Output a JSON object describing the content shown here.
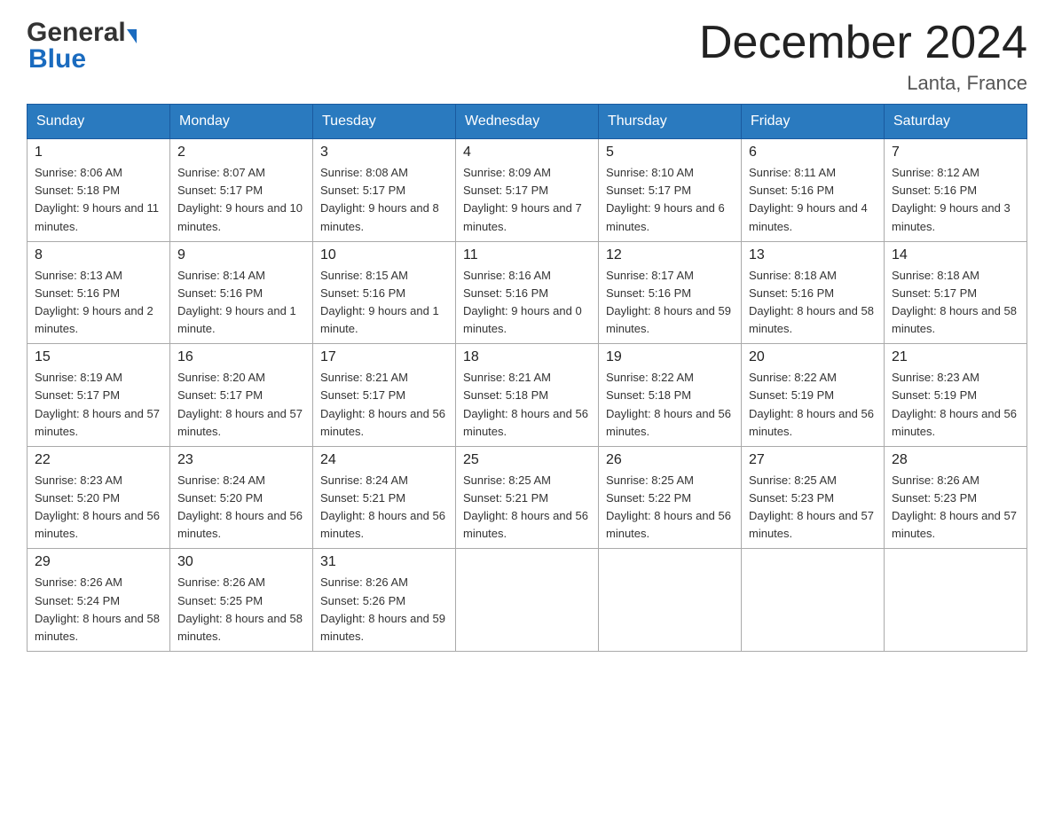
{
  "logo": {
    "general": "General",
    "blue": "Blue"
  },
  "header": {
    "month_year": "December 2024",
    "location": "Lanta, France"
  },
  "columns": [
    "Sunday",
    "Monday",
    "Tuesday",
    "Wednesday",
    "Thursday",
    "Friday",
    "Saturday"
  ],
  "weeks": [
    [
      {
        "day": "1",
        "sunrise": "8:06 AM",
        "sunset": "5:18 PM",
        "daylight": "9 hours and 11 minutes."
      },
      {
        "day": "2",
        "sunrise": "8:07 AM",
        "sunset": "5:17 PM",
        "daylight": "9 hours and 10 minutes."
      },
      {
        "day": "3",
        "sunrise": "8:08 AM",
        "sunset": "5:17 PM",
        "daylight": "9 hours and 8 minutes."
      },
      {
        "day": "4",
        "sunrise": "8:09 AM",
        "sunset": "5:17 PM",
        "daylight": "9 hours and 7 minutes."
      },
      {
        "day": "5",
        "sunrise": "8:10 AM",
        "sunset": "5:17 PM",
        "daylight": "9 hours and 6 minutes."
      },
      {
        "day": "6",
        "sunrise": "8:11 AM",
        "sunset": "5:16 PM",
        "daylight": "9 hours and 4 minutes."
      },
      {
        "day": "7",
        "sunrise": "8:12 AM",
        "sunset": "5:16 PM",
        "daylight": "9 hours and 3 minutes."
      }
    ],
    [
      {
        "day": "8",
        "sunrise": "8:13 AM",
        "sunset": "5:16 PM",
        "daylight": "9 hours and 2 minutes."
      },
      {
        "day": "9",
        "sunrise": "8:14 AM",
        "sunset": "5:16 PM",
        "daylight": "9 hours and 1 minute."
      },
      {
        "day": "10",
        "sunrise": "8:15 AM",
        "sunset": "5:16 PM",
        "daylight": "9 hours and 1 minute."
      },
      {
        "day": "11",
        "sunrise": "8:16 AM",
        "sunset": "5:16 PM",
        "daylight": "9 hours and 0 minutes."
      },
      {
        "day": "12",
        "sunrise": "8:17 AM",
        "sunset": "5:16 PM",
        "daylight": "8 hours and 59 minutes."
      },
      {
        "day": "13",
        "sunrise": "8:18 AM",
        "sunset": "5:16 PM",
        "daylight": "8 hours and 58 minutes."
      },
      {
        "day": "14",
        "sunrise": "8:18 AM",
        "sunset": "5:17 PM",
        "daylight": "8 hours and 58 minutes."
      }
    ],
    [
      {
        "day": "15",
        "sunrise": "8:19 AM",
        "sunset": "5:17 PM",
        "daylight": "8 hours and 57 minutes."
      },
      {
        "day": "16",
        "sunrise": "8:20 AM",
        "sunset": "5:17 PM",
        "daylight": "8 hours and 57 minutes."
      },
      {
        "day": "17",
        "sunrise": "8:21 AM",
        "sunset": "5:17 PM",
        "daylight": "8 hours and 56 minutes."
      },
      {
        "day": "18",
        "sunrise": "8:21 AM",
        "sunset": "5:18 PM",
        "daylight": "8 hours and 56 minutes."
      },
      {
        "day": "19",
        "sunrise": "8:22 AM",
        "sunset": "5:18 PM",
        "daylight": "8 hours and 56 minutes."
      },
      {
        "day": "20",
        "sunrise": "8:22 AM",
        "sunset": "5:19 PM",
        "daylight": "8 hours and 56 minutes."
      },
      {
        "day": "21",
        "sunrise": "8:23 AM",
        "sunset": "5:19 PM",
        "daylight": "8 hours and 56 minutes."
      }
    ],
    [
      {
        "day": "22",
        "sunrise": "8:23 AM",
        "sunset": "5:20 PM",
        "daylight": "8 hours and 56 minutes."
      },
      {
        "day": "23",
        "sunrise": "8:24 AM",
        "sunset": "5:20 PM",
        "daylight": "8 hours and 56 minutes."
      },
      {
        "day": "24",
        "sunrise": "8:24 AM",
        "sunset": "5:21 PM",
        "daylight": "8 hours and 56 minutes."
      },
      {
        "day": "25",
        "sunrise": "8:25 AM",
        "sunset": "5:21 PM",
        "daylight": "8 hours and 56 minutes."
      },
      {
        "day": "26",
        "sunrise": "8:25 AM",
        "sunset": "5:22 PM",
        "daylight": "8 hours and 56 minutes."
      },
      {
        "day": "27",
        "sunrise": "8:25 AM",
        "sunset": "5:23 PM",
        "daylight": "8 hours and 57 minutes."
      },
      {
        "day": "28",
        "sunrise": "8:26 AM",
        "sunset": "5:23 PM",
        "daylight": "8 hours and 57 minutes."
      }
    ],
    [
      {
        "day": "29",
        "sunrise": "8:26 AM",
        "sunset": "5:24 PM",
        "daylight": "8 hours and 58 minutes."
      },
      {
        "day": "30",
        "sunrise": "8:26 AM",
        "sunset": "5:25 PM",
        "daylight": "8 hours and 58 minutes."
      },
      {
        "day": "31",
        "sunrise": "8:26 AM",
        "sunset": "5:26 PM",
        "daylight": "8 hours and 59 minutes."
      },
      null,
      null,
      null,
      null
    ]
  ]
}
